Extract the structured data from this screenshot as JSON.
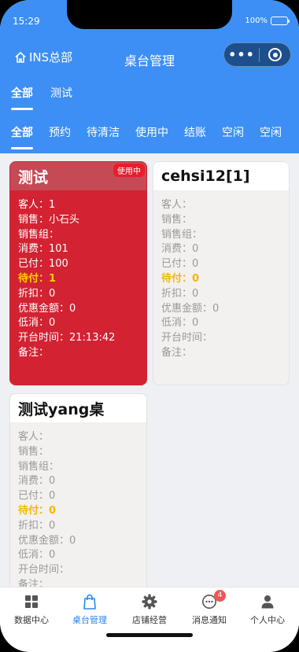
{
  "status": {
    "time": "15:29",
    "battery": "100%"
  },
  "nav": {
    "home_label": "INS总部",
    "title": "桌台管理",
    "more": "•••"
  },
  "area_tabs": [
    {
      "label": "全部",
      "active": true
    },
    {
      "label": "测试",
      "active": false
    }
  ],
  "status_tabs": [
    {
      "label": "全部",
      "active": true
    },
    {
      "label": "预约",
      "active": false
    },
    {
      "label": "待清洁",
      "active": false
    },
    {
      "label": "使用中",
      "active": false
    },
    {
      "label": "结账",
      "active": false
    },
    {
      "label": "空闲",
      "active": false
    },
    {
      "label": "空闲",
      "active": false
    }
  ],
  "tables": [
    {
      "name": "测试",
      "badge": "使用中",
      "rows": [
        "客人：1",
        "销售：小石头",
        "销售组：",
        "消费：101",
        "已付：100",
        "待付：1",
        "折扣：0",
        "优惠金额：0",
        "低消：0",
        "开台时间：21:13:42",
        "备注："
      ]
    },
    {
      "name": "cehsi12[1]",
      "badge": "",
      "rows": [
        "客人：",
        "销售：",
        "销售组：",
        "消费：0",
        "已付：0",
        "待付：0",
        "折扣：0",
        "优惠金额：0",
        "低消：0",
        "开台时间：",
        "备注："
      ]
    },
    {
      "name": "测试yang桌",
      "badge": "",
      "rows": [
        "客人：",
        "销售：",
        "销售组：",
        "消费：0",
        "已付：0",
        "待付：0",
        "折扣：0",
        "优惠金额：0",
        "低消：0",
        "开台时间：",
        "备注："
      ]
    }
  ],
  "tabbar": [
    {
      "label": "数据中心",
      "icon": "grid-icon"
    },
    {
      "label": "桌台管理",
      "icon": "bag-icon"
    },
    {
      "label": "店铺经营",
      "icon": "gear-icon"
    },
    {
      "label": "消息通知",
      "icon": "chat-icon",
      "badge": "4"
    },
    {
      "label": "个人中心",
      "icon": "person-icon"
    }
  ],
  "colors": {
    "header": "#3d8ff5",
    "active_card": "#d32232",
    "due_text": "#f5b800",
    "tab_active": "#2a86f0"
  }
}
